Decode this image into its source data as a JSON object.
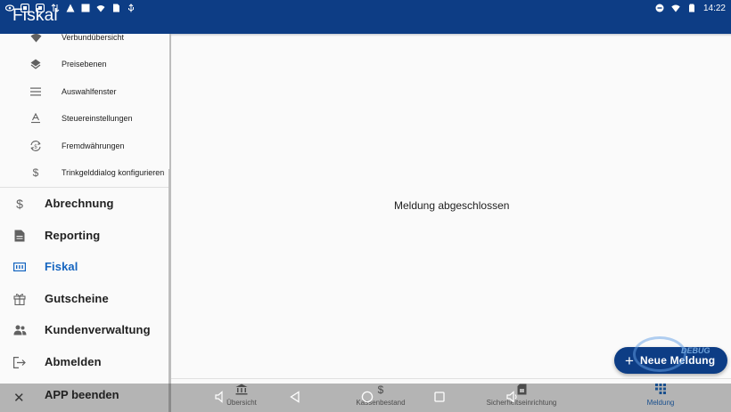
{
  "statusbar": {
    "time": "14:22"
  },
  "app": {
    "title": "Fiskal"
  },
  "drawer": {
    "subitems": [
      {
        "label": "Verbundübersicht",
        "icon": "wifi-icon"
      },
      {
        "label": "Preisebenen",
        "icon": "layers-icon"
      },
      {
        "label": "Auswahlfenster",
        "icon": "menu-icon"
      },
      {
        "label": "Steuereinstellungen",
        "icon": "text-format-icon"
      },
      {
        "label": "Fremdwährungen",
        "icon": "currency-exchange-icon"
      },
      {
        "label": "Trinkgelddialog konfigurieren",
        "icon": "dollar-icon"
      }
    ],
    "items": [
      {
        "label": "Abrechnung",
        "icon": "dollar-icon"
      },
      {
        "label": "Reporting",
        "icon": "document-icon"
      },
      {
        "label": "Fiskal",
        "icon": "fiscal-counter-icon"
      },
      {
        "label": "Gutscheine",
        "icon": "gift-icon"
      },
      {
        "label": "Kundenverwaltung",
        "icon": "people-icon"
      },
      {
        "label": "Abmelden",
        "icon": "logout-icon"
      },
      {
        "label": "APP beenden",
        "icon": "close-icon"
      }
    ]
  },
  "main": {
    "message": "Meldung abgeschlossen"
  },
  "fab": {
    "label": "Neue Meldung"
  },
  "watermark": {
    "text": "DEBUG"
  },
  "bottomnav": {
    "tabs": [
      {
        "label": "Übersicht",
        "icon": "bank-icon"
      },
      {
        "label": "Kassenbestand",
        "icon": "dollar-icon"
      },
      {
        "label": "Sicherheitseinrichtung",
        "icon": "sim-card-icon"
      },
      {
        "label": "Meldung",
        "icon": "grid-icon"
      }
    ]
  },
  "colors": {
    "primary": "#0d3d85",
    "active": "#1565c0"
  }
}
